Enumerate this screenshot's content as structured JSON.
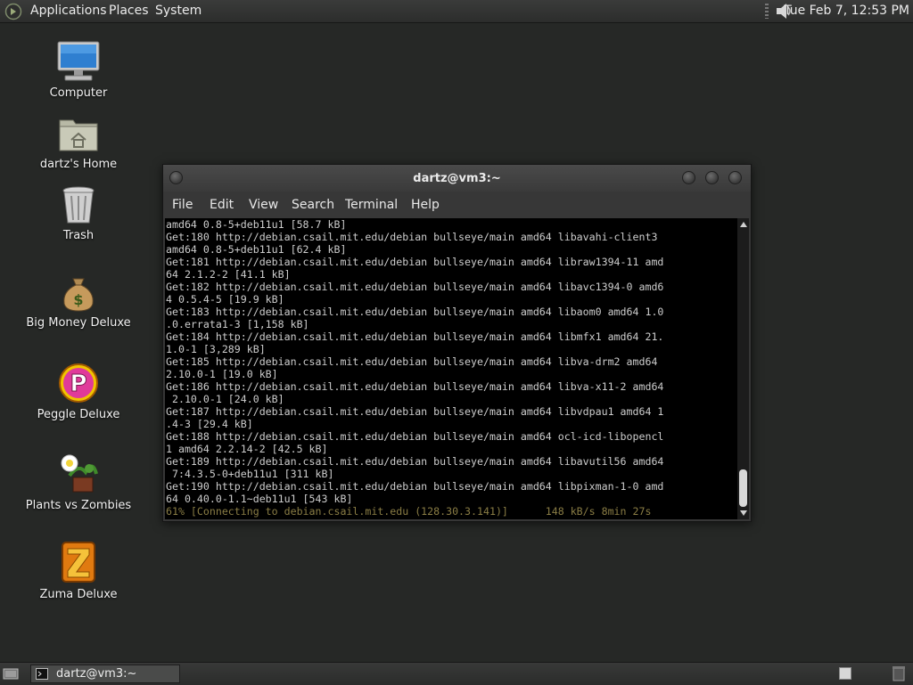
{
  "top_panel": {
    "menus": [
      "Applications",
      "Places",
      "System"
    ],
    "clock": "Tue Feb  7, 12:53 PM",
    "icons": [
      "distro-logo-icon",
      "volume-icon"
    ]
  },
  "desktop": {
    "icons": [
      {
        "label": "Computer",
        "icon": "computer-icon"
      },
      {
        "label": "dartz's Home",
        "icon": "home-folder-icon"
      },
      {
        "label": "Trash",
        "icon": "trash-icon"
      },
      {
        "label": "Big Money Deluxe",
        "icon": "money-bag-icon"
      },
      {
        "label": "Peggle Deluxe",
        "icon": "peggle-icon"
      },
      {
        "label": "Plants vs Zombies",
        "icon": "plants-vs-zombies-icon"
      },
      {
        "label": "Zuma Deluxe",
        "icon": "zuma-icon"
      }
    ]
  },
  "terminal": {
    "title": "dartz@vm3:~",
    "menu": [
      "File",
      "Edit",
      "View",
      "Search",
      "Terminal",
      "Help"
    ],
    "lines": [
      "amd64 0.8-5+deb11u1 [58.7 kB]",
      "Get:180 http://debian.csail.mit.edu/debian bullseye/main amd64 libavahi-client3",
      "amd64 0.8-5+deb11u1 [62.4 kB]",
      "Get:181 http://debian.csail.mit.edu/debian bullseye/main amd64 libraw1394-11 amd",
      "64 2.1.2-2 [41.1 kB]",
      "Get:182 http://debian.csail.mit.edu/debian bullseye/main amd64 libavc1394-0 amd6",
      "4 0.5.4-5 [19.9 kB]",
      "Get:183 http://debian.csail.mit.edu/debian bullseye/main amd64 libaom0 amd64 1.0",
      ".0.errata1-3 [1,158 kB]",
      "Get:184 http://debian.csail.mit.edu/debian bullseye/main amd64 libmfx1 amd64 21.",
      "1.0-1 [3,289 kB]",
      "Get:185 http://debian.csail.mit.edu/debian bullseye/main amd64 libva-drm2 amd64",
      "2.10.0-1 [19.0 kB]",
      "Get:186 http://debian.csail.mit.edu/debian bullseye/main amd64 libva-x11-2 amd64",
      " 2.10.0-1 [24.0 kB]",
      "Get:187 http://debian.csail.mit.edu/debian bullseye/main amd64 libvdpau1 amd64 1",
      ".4-3 [29.4 kB]",
      "Get:188 http://debian.csail.mit.edu/debian bullseye/main amd64 ocl-icd-libopencl",
      "1 amd64 2.2.14-2 [42.5 kB]",
      "Get:189 http://debian.csail.mit.edu/debian bullseye/main amd64 libavutil56 amd64",
      " 7:4.3.5-0+deb11u1 [311 kB]",
      "Get:190 http://debian.csail.mit.edu/debian bullseye/main amd64 libpixman-1-0 amd",
      "64 0.40.0-1.1~deb11u1 [543 kB]"
    ],
    "status_line": "61% [Connecting to debian.csail.mit.edu (128.30.3.141)]      148 kB/s 8min 27s",
    "status_color": "#8a7d45"
  },
  "bottom_panel": {
    "task_label": "dartz@vm3:~",
    "icons": [
      "show-desktop-icon",
      "terminal-icon",
      "workspace-icon",
      "trash-applet-icon"
    ]
  },
  "colors": {
    "desktop_bg": "#262826",
    "terminal_bg": "#000000",
    "terminal_text": "#cdcdcd"
  }
}
